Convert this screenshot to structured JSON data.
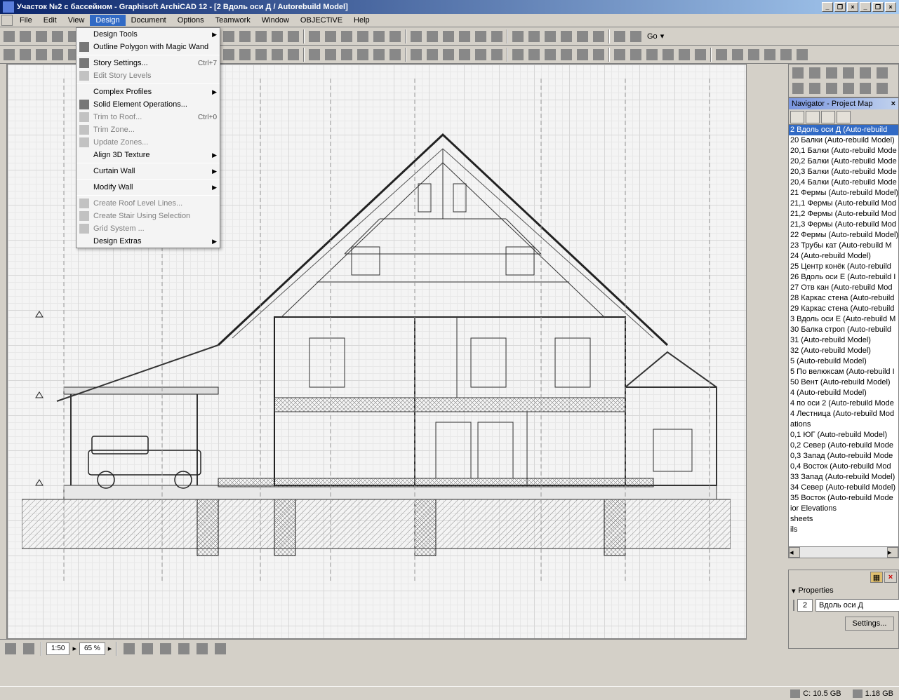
{
  "titlebar": {
    "text": "Участок №2 с бассейном  - Graphisoft ArchiCAD 12 - [2 Вдоль оси Д / Autorebuild Model]"
  },
  "menubar": {
    "items": [
      "File",
      "Edit",
      "View",
      "Design",
      "Document",
      "Options",
      "Teamwork",
      "Window",
      "OBJECTiVE",
      "Help"
    ],
    "active_index": 3
  },
  "design_menu": {
    "items": [
      {
        "label": "Design Tools",
        "submenu": true
      },
      {
        "label": "Outline Polygon with Magic Wand",
        "icon": true
      },
      {
        "sep": true
      },
      {
        "label": "Story Settings...",
        "shortcut": "Ctrl+7",
        "icon": true
      },
      {
        "label": "Edit Story Levels",
        "icon": true,
        "disabled": true
      },
      {
        "sep": true
      },
      {
        "label": "Complex Profiles",
        "submenu": true
      },
      {
        "label": "Solid Element Operations...",
        "icon": true
      },
      {
        "label": "Trim to Roof...",
        "shortcut": "Ctrl+0",
        "icon": true,
        "disabled": true
      },
      {
        "label": "Trim Zone...",
        "icon": true,
        "disabled": true
      },
      {
        "label": "Update Zones...",
        "icon": true,
        "disabled": true
      },
      {
        "label": "Align 3D Texture",
        "submenu": true
      },
      {
        "sep": true
      },
      {
        "label": "Curtain Wall",
        "submenu": true
      },
      {
        "sep": true
      },
      {
        "label": "Modify Wall",
        "submenu": true
      },
      {
        "sep": true
      },
      {
        "label": "Create Roof Level Lines...",
        "icon": true,
        "disabled": true
      },
      {
        "label": "Create Stair Using Selection",
        "icon": true,
        "disabled": true
      },
      {
        "label": "Grid System ...",
        "icon": true,
        "disabled": true
      },
      {
        "label": "Design Extras",
        "submenu": true
      }
    ]
  },
  "navigator": {
    "title": "Navigator - Project Map",
    "selected": "2 Вдоль оси Д (Auto-rebuild",
    "items": [
      "2 Вдоль оси Д (Auto-rebuild",
      "20 Балки (Auto-rebuild Model)",
      "20,1 Балки (Auto-rebuild Mode",
      "20,2 Балки (Auto-rebuild Mode",
      "20,3 Балки (Auto-rebuild Mode",
      "20,4 Балки (Auto-rebuild Mode",
      "21 Фермы (Auto-rebuild Model)",
      "21,1 Фермы (Auto-rebuild Mod",
      "21,2 Фермы (Auto-rebuild Mod",
      "21,3 Фермы (Auto-rebuild Mod",
      "22 Фермы (Auto-rebuild Model)",
      "23 Трубы кат (Auto-rebuild M",
      "24 (Auto-rebuild Model)",
      "25 Центр конёк (Auto-rebuild",
      "26 Вдоль оси Е (Auto-rebuild I",
      "27 Отв кан (Auto-rebuild Mod",
      "28 Каркас стена (Auto-rebuild",
      "29 Каркас стена (Auto-rebuild",
      "3 Вдоль оси Е (Auto-rebuild M",
      "30 Балка строп (Auto-rebuild",
      "31 (Auto-rebuild Model)",
      "32 (Auto-rebuild Model)",
      "5 (Auto-rebuild Model)",
      "5 По велюксам (Auto-rebuild I",
      "50 Вент (Auto-rebuild Model)",
      "4 (Auto-rebuild Model)",
      "4 по оси 2 (Auto-rebuild Mode",
      "4 Лестница (Auto-rebuild Mod",
      "ations",
      "0,1 ЮГ (Auto-rebuild Model)",
      "0,2 Север (Auto-rebuild Mode",
      "0,3 Запад (Auto-rebuild Mode",
      "0,4 Восток (Auto-rebuild Mod",
      "33 Запад (Auto-rebuild Model)",
      "34 Север (Auto-rebuild Model)",
      "35 Восток (Auto-rebuild Mode",
      "ior Elevations",
      "sheets",
      "ils"
    ]
  },
  "properties": {
    "header": "Properties",
    "number": "2",
    "name": "Вдоль оси Д",
    "settings_btn": "Settings..."
  },
  "bottom": {
    "scale": "1:50",
    "zoom": "65 %"
  },
  "toolbar2_go": "Go",
  "status": {
    "disk": "C: 10.5 GB",
    "memory": "1.18 GB"
  }
}
